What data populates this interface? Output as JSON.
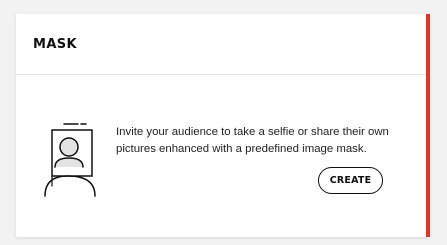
{
  "card": {
    "title": "MASK",
    "description": "Invite your audience to take a selfie or share their own pictures enhanced with a predefined image mask.",
    "create_label": "CREATE",
    "illustration_icon": "selfie-portrait-icon",
    "accent_color": "#d83a26"
  }
}
